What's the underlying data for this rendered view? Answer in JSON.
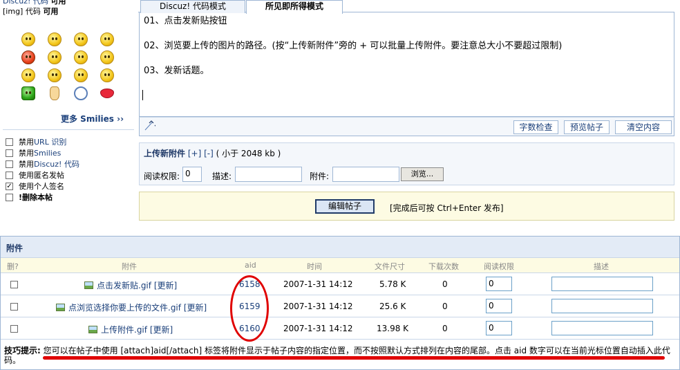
{
  "left": {
    "bbcode_rows": [
      {
        "key": "Discuz! 代码",
        "status": "可用"
      },
      {
        "key": "[img] 代码",
        "status": "可用"
      }
    ],
    "more_smilies": "更多 Smilies ››",
    "options": [
      {
        "label_prefix": "禁用 ",
        "label_key": "URL 识别",
        "checked": false
      },
      {
        "label_prefix": "禁用 ",
        "label_key": "Smilies",
        "checked": false
      },
      {
        "label_prefix": "禁用 ",
        "label_key": "Discuz! 代码",
        "checked": false
      },
      {
        "label_prefix": "使用匿名发帖",
        "label_key": "",
        "checked": false
      },
      {
        "label_prefix": "使用个人签名",
        "label_key": "",
        "checked": true
      },
      {
        "label_prefix": "!删除本帖",
        "label_key": "",
        "checked": false
      }
    ],
    "smilies": [
      "smile-icon",
      "sad-icon",
      "big-smile-icon",
      "cry-icon",
      "angry-icon",
      "confused-icon",
      "wink-icon",
      "shy-icon",
      "shout-icon",
      "tongue-icon",
      "laugh-icon",
      "grin-icon",
      "green-man-icon",
      "victory-icon",
      "clock-icon",
      "lips-icon"
    ]
  },
  "editor": {
    "tabs": [
      "Discuz! 代码模式",
      "所见即所得模式"
    ],
    "active_tab": "所见即所得模式",
    "lines": [
      "01、点击发新贴按钮",
      "02、浏览要上传的图片的路径。(按“上传新附件”旁的 +  可以批量上传附件。要注意总大小不要超过限制)",
      "03、发新话题。"
    ],
    "buttons": [
      "字数检查",
      "预览帖子",
      "清空内容"
    ]
  },
  "upload": {
    "title": "上传新附件",
    "add": "[+]",
    "remove": "[-]",
    "limit": "( 小于 2048 kb )",
    "read_perm_label": "阅读权限:",
    "read_perm_value": "0",
    "desc_label": "描述:",
    "file_label": "附件:",
    "browse": "浏览..."
  },
  "submit": {
    "button": "编辑帖子",
    "hint": "[完成后可按 Ctrl+Enter 发布]"
  },
  "attachments": {
    "title": "附件",
    "columns": [
      "删?",
      "附件",
      "aid",
      "时间",
      "文件尺寸",
      "下载次数",
      "阅读权限",
      "描述"
    ],
    "rows": [
      {
        "name": "点击发新贴.gif",
        "update": "[更新]",
        "aid": "6158",
        "time": "2007-1-31 14:12",
        "size": "5.78 K",
        "downloads": "0",
        "perm": "0"
      },
      {
        "name": "点浏览选择你要上传的文件.gif",
        "update": "[更新]",
        "aid": "6159",
        "time": "2007-1-31 14:12",
        "size": "25.6 K",
        "downloads": "0",
        "perm": "0"
      },
      {
        "name": "上传附件.gif",
        "update": "[更新]",
        "aid": "6160",
        "time": "2007-1-31 14:12",
        "size": "13.98 K",
        "downloads": "0",
        "perm": "0"
      }
    ],
    "tips_label": "技巧提示:",
    "tips_text": "您可以在帖子中使用 [attach]aid[/attach] 标签将附件显示于帖子内容的指定位置，而不按照默认方式排列在内容的尾部。点击 aid 数字可以在当前光标位置自动插入此代码。"
  },
  "colors": {
    "border": "#9eb6d4",
    "link": "#1a3f7a",
    "header_bg": "#e3ebf6",
    "annotation": "#e00000"
  }
}
